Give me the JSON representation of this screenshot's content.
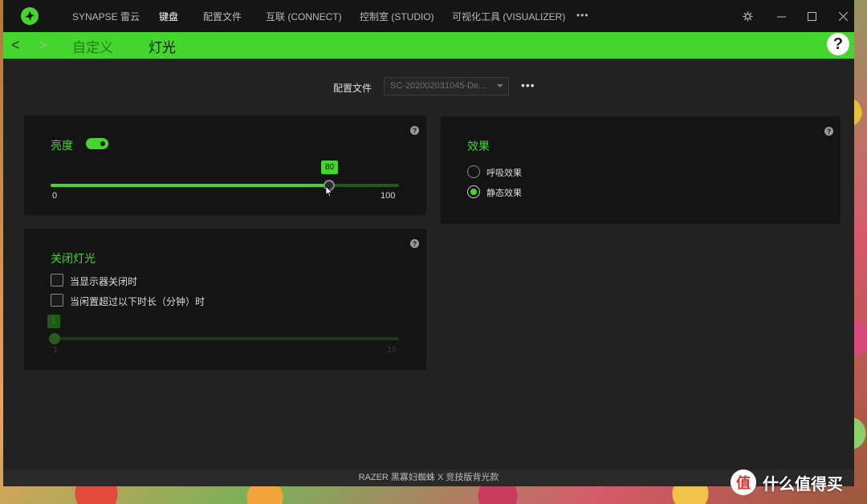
{
  "titlebar": {
    "nav": [
      "SYNAPSE 雷云",
      "键盘",
      "配置文件",
      "互联 (CONNECT)",
      "控制室 (STUDIO)",
      "可视化工具 (VISUALIZER)"
    ],
    "more": "•••",
    "active_index": 1
  },
  "greenbar": {
    "back": "<",
    "forward": ">",
    "tabs": [
      "自定义",
      "灯光"
    ],
    "active_tab": "灯光",
    "help": "?"
  },
  "profile": {
    "label": "配置文件",
    "value": "SC-202002031045-De...",
    "more": "•••"
  },
  "brightness": {
    "title": "亮度",
    "enabled": true,
    "value": "80",
    "value_num": 80,
    "min": "0",
    "max": "100",
    "help": "?"
  },
  "lighting_off": {
    "title": "关闭灯光",
    "option1": "当显示器关闭时",
    "option2": "当闲置超过以下时长（分钟）时",
    "slider_value": "1",
    "slider_value_num": 1,
    "min": "1",
    "max": "15",
    "help": "?"
  },
  "effects": {
    "title": "效果",
    "options": [
      "呼吸效果",
      "静态效果"
    ],
    "selected": "静态效果",
    "help": "?"
  },
  "status_bar": "RAZER 黑寡妇蜘蛛 X 竞技版背光款",
  "watermark": {
    "logo": "值",
    "text": "什么值得买"
  },
  "colors": {
    "accent": "#44d62c",
    "window_bg": "#222222",
    "panel_bg": "#141414",
    "titlebar_bg": "#151515"
  }
}
